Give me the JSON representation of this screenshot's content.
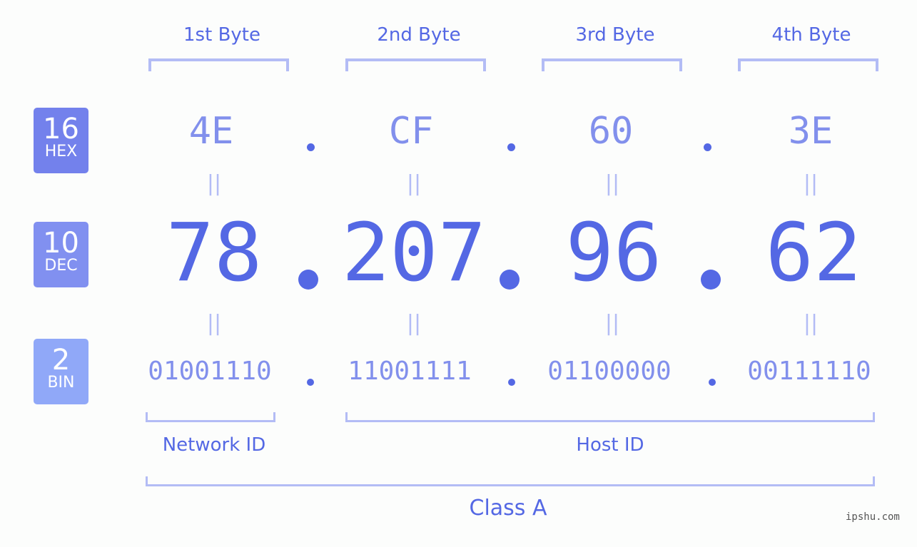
{
  "header": {
    "byte_labels": [
      "1st Byte",
      "2nd Byte",
      "3rd Byte",
      "4th Byte"
    ]
  },
  "badges": {
    "hex": {
      "num": "16",
      "label": "HEX",
      "color": "#7381ec"
    },
    "dec": {
      "num": "10",
      "label": "DEC",
      "color": "#8190f0"
    },
    "bin": {
      "num": "2",
      "label": "BIN",
      "color": "#90a8f8"
    }
  },
  "ip": {
    "hex": [
      "4E",
      "CF",
      "60",
      "3E"
    ],
    "dec": [
      "78",
      "207",
      "96",
      "62"
    ],
    "bin": [
      "01001110",
      "11001111",
      "01100000",
      "00111110"
    ],
    "separator": ".",
    "equals": "||"
  },
  "groups": {
    "network_id": "Network ID",
    "host_id": "Host ID",
    "class": "Class A"
  },
  "colors": {
    "primary": "#5468e4",
    "secondary": "#8290ec",
    "bracket": "#b3bcf5",
    "background": "#fcfdfc"
  },
  "watermark": "ipshu.com"
}
